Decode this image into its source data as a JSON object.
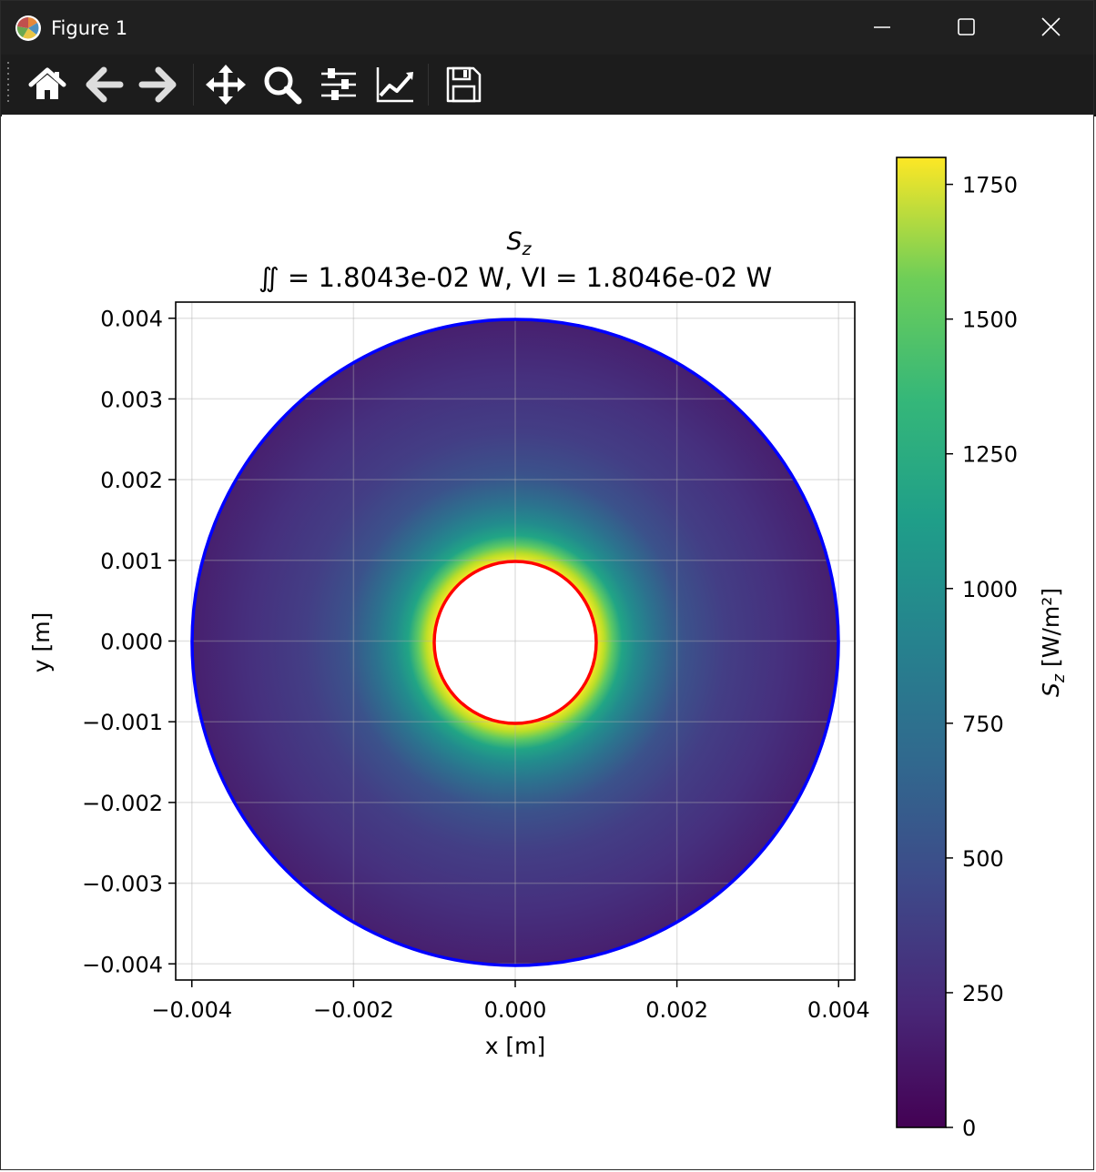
{
  "window": {
    "title": "Figure 1",
    "icon": "matplotlib-icon",
    "controls": [
      "minimize-icon",
      "maximize-icon",
      "close-icon"
    ]
  },
  "toolbar": {
    "buttons": [
      {
        "name": "home",
        "icon": "home-icon"
      },
      {
        "name": "back",
        "icon": "arrow-left-icon"
      },
      {
        "name": "forward",
        "icon": "arrow-right-icon"
      },
      {
        "name": "pan",
        "icon": "move-icon"
      },
      {
        "name": "zoom",
        "icon": "magnifier-icon"
      },
      {
        "name": "subplots",
        "icon": "sliders-icon"
      },
      {
        "name": "edit-axes",
        "icon": "line-chart-icon"
      },
      {
        "name": "save",
        "icon": "floppy-disk-icon"
      }
    ]
  },
  "chart_data": {
    "type": "heatmap",
    "title_line1": "S_z",
    "title_line2": "∬ = 1.8043e-02 W,   VI = 1.8046e-02 W",
    "xlabel": "x [m]",
    "ylabel": "y [m]",
    "xlim": [
      -0.0042,
      0.0042
    ],
    "ylim": [
      -0.0042,
      0.0042
    ],
    "xticks": [
      -0.004,
      -0.002,
      0.0,
      0.002,
      0.004
    ],
    "xtick_labels": [
      "−0.004",
      "−0.002",
      "0.000",
      "0.002",
      "0.004"
    ],
    "yticks": [
      0.004,
      0.003,
      0.002,
      0.001,
      0.0,
      -0.001,
      -0.002,
      -0.003,
      -0.004
    ],
    "ytick_labels": [
      "0.004",
      "0.003",
      "0.002",
      "0.001",
      "0.000",
      "−0.001",
      "−0.002",
      "−0.003",
      "−0.004"
    ],
    "grid": true,
    "field": "annulus",
    "inner_radius": 0.001,
    "outer_radius": 0.004,
    "inner_circle_color": "#ff0000",
    "outer_circle_color": "#0000ff",
    "colormap": "viridis",
    "colorbar": {
      "label": "S_z [W/m²]",
      "min": 0,
      "max": 1800,
      "ticks": [
        0,
        250,
        500,
        750,
        1000,
        1250,
        1500,
        1750
      ],
      "tick_labels": [
        "0",
        "250",
        "500",
        "750",
        "1000",
        "1250",
        "1500",
        "1750"
      ]
    }
  }
}
